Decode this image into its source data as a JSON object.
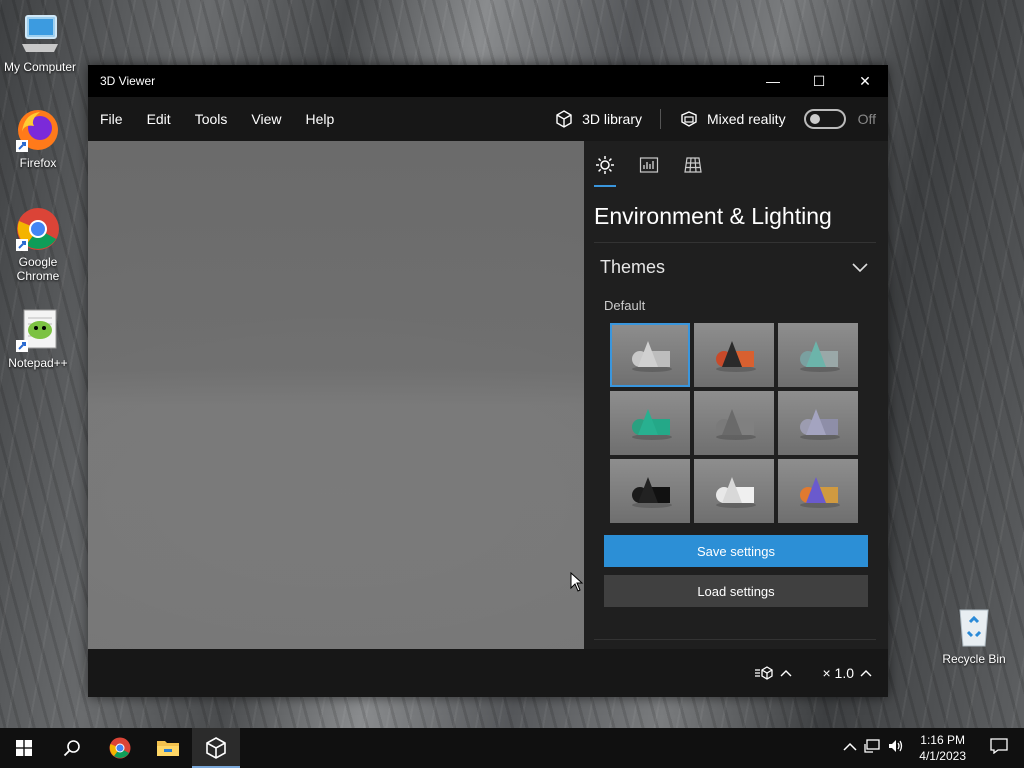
{
  "desktop": {
    "icons": [
      {
        "label": "My Computer"
      },
      {
        "label": "Firefox"
      },
      {
        "label": "Google Chrome"
      },
      {
        "label": "Notepad++"
      },
      {
        "label": "Recycle Bin"
      }
    ]
  },
  "window": {
    "title": "3D Viewer",
    "controls": {
      "minimize": "—",
      "maximize": "☐",
      "close": "✕"
    }
  },
  "menubar": {
    "items": [
      "File",
      "Edit",
      "Tools",
      "View",
      "Help"
    ],
    "library_label": "3D library",
    "mixed_reality_label": "Mixed reality",
    "mixed_reality_state": "Off"
  },
  "panel": {
    "title": "Environment & Lighting",
    "section": "Themes",
    "subsection": "Default",
    "themes": [
      {
        "name": "theme-white",
        "colors": [
          "#c8c8c8",
          "#d0d0d0",
          "#bdbdbd"
        ]
      },
      {
        "name": "theme-warm",
        "colors": [
          "#c84a2a",
          "#2a2a2a",
          "#d86030"
        ]
      },
      {
        "name": "theme-teal-grey",
        "colors": [
          "#7aa0a0",
          "#6cb4aa",
          "#9aa8a8"
        ]
      },
      {
        "name": "theme-teal",
        "colors": [
          "#2aa080",
          "#28b090",
          "#24a888"
        ]
      },
      {
        "name": "theme-grey",
        "colors": [
          "#7a7a7a",
          "#6a6a6a",
          "#808080"
        ]
      },
      {
        "name": "theme-lavender",
        "colors": [
          "#9c9cb0",
          "#a4a4c0",
          "#8e8ea8"
        ]
      },
      {
        "name": "theme-black",
        "colors": [
          "#1a1a1a",
          "#222222",
          "#111111"
        ]
      },
      {
        "name": "theme-bright",
        "colors": [
          "#e8e8e8",
          "#d8d8d8",
          "#f0f0f0"
        ]
      },
      {
        "name": "theme-multicolor",
        "colors": [
          "#e07a30",
          "#6a5acd",
          "#d09a40"
        ]
      }
    ],
    "save_label": "Save settings",
    "load_label": "Load settings"
  },
  "statusbar": {
    "zoom_label": "× 1.0"
  },
  "taskbar": {
    "time": "1:16 PM",
    "date": "4/1/2023"
  },
  "colors": {
    "accent": "#2c8fd6",
    "titlebar": "#000000",
    "panel_bg": "#1f1f1f"
  }
}
